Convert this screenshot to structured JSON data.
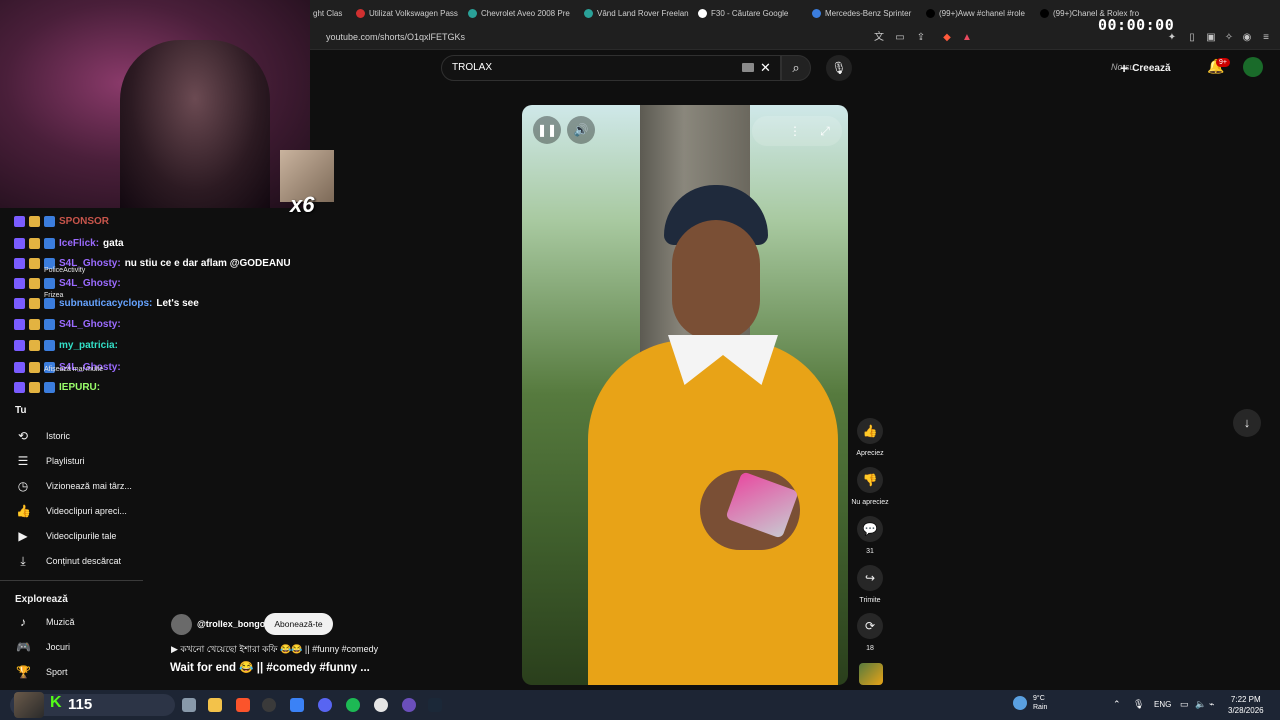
{
  "browser": {
    "tabs": [
      {
        "label": "ght Clas",
        "color": "#888888"
      },
      {
        "label": "Utilizat Volkswagen Pass",
        "color": "#d03030"
      },
      {
        "label": "Chevrolet Aveo 2008 Pre",
        "color": "#2aa198"
      },
      {
        "label": "Vând Land Rover Freelan",
        "color": "#2aa198"
      },
      {
        "label": "F30 - Căutare Google",
        "color": "#ffffff"
      },
      {
        "label": "Mercedes-Benz Sprinter",
        "color": "#3b7ddd"
      },
      {
        "label": "(99+)Aww #chanel #role",
        "color": "#000000"
      },
      {
        "label": "(99+)Chanel & Rolex fro",
        "color": "#000000"
      }
    ],
    "url": "youtube.com/shorts/O1qxlFETGKs",
    "timer": "00:00:00"
  },
  "overlay": {
    "multiplier": "x6",
    "chat": [
      {
        "user": "SPONSOR",
        "message": "",
        "user_color": "#c8554b"
      },
      {
        "user": "IceFlick:",
        "message": "gata",
        "user_color": "#9b6bff"
      },
      {
        "user": "S4L_Ghosty:",
        "message": "nu stiu ce e dar aflam @GODEANU",
        "user_color": "#9b6bff"
      },
      {
        "user": "S4L_Ghosty:",
        "message": "",
        "user_color": "#9b6bff"
      },
      {
        "user": "subnauticacyclops:",
        "message": "Let's see",
        "user_color": "#66a3ff"
      },
      {
        "user": "S4L_Ghosty:",
        "message": "",
        "user_color": "#9b6bff"
      },
      {
        "user": "my_patricia:",
        "message": "",
        "user_color": "#33e0c8"
      },
      {
        "user": "S4L_Ghosty:",
        "message": "",
        "user_color": "#9b6bff"
      },
      {
        "user": "IEPURU:",
        "message": "",
        "user_color": "#9bff6b"
      }
    ],
    "sub_notes": [
      "PoliceActivity",
      "Frizea",
      "Afișează mai multe"
    ]
  },
  "sidebar": {
    "you_title": "Tu",
    "you_items": [
      {
        "label": "Istoric",
        "icon": "history-icon",
        "glyph": "⟲"
      },
      {
        "label": "Playlisturi",
        "icon": "playlist-icon",
        "glyph": "☰"
      },
      {
        "label": "Vizionează mai târz...",
        "icon": "clock-icon",
        "glyph": "◷"
      },
      {
        "label": "Videoclipuri apreci...",
        "icon": "thumbs-up-icon",
        "glyph": "👍"
      },
      {
        "label": "Videoclipurile tale",
        "icon": "video-icon",
        "glyph": "▶"
      },
      {
        "label": "Conținut descărcat",
        "icon": "download-icon",
        "glyph": "⤓"
      }
    ],
    "explore_title": "Explorează",
    "explore_items": [
      {
        "label": "Muzică",
        "icon": "music-icon",
        "glyph": "♪"
      },
      {
        "label": "Jocuri",
        "icon": "gamepad-icon",
        "glyph": "🎮"
      },
      {
        "label": "Sport",
        "icon": "trophy-icon",
        "glyph": "🏆"
      }
    ]
  },
  "header": {
    "search_value": "TROLAX",
    "no_sub_text": "No su",
    "create_label": "Creează",
    "notification_badge": "9+"
  },
  "short": {
    "actions": [
      {
        "label": "Apreciez",
        "icon": "like-icon",
        "glyph": "👍"
      },
      {
        "label": "Nu apreciez",
        "icon": "dislike-icon",
        "glyph": "👎"
      },
      {
        "label": "31",
        "icon": "comment-icon",
        "glyph": "💬"
      },
      {
        "label": "Trimite",
        "icon": "share-icon",
        "glyph": "↪"
      },
      {
        "label": "18",
        "icon": "remix-icon",
        "glyph": "⟳"
      }
    ],
    "channel": "@trollex_bongo",
    "subscribe_label": "Abonează-te",
    "description_line": "▶  কখনো খেয়েছো ইশারা কফি 😂😂 || #funny #comedy",
    "title": "Wait for end 😂 || #comedy #funny ..."
  },
  "taskbar": {
    "kick_count": "115",
    "weather_temp": "9°C",
    "weather_desc": "Rain",
    "lang": "ENG",
    "time": "7:22 PM",
    "date": "3/28/2026"
  }
}
